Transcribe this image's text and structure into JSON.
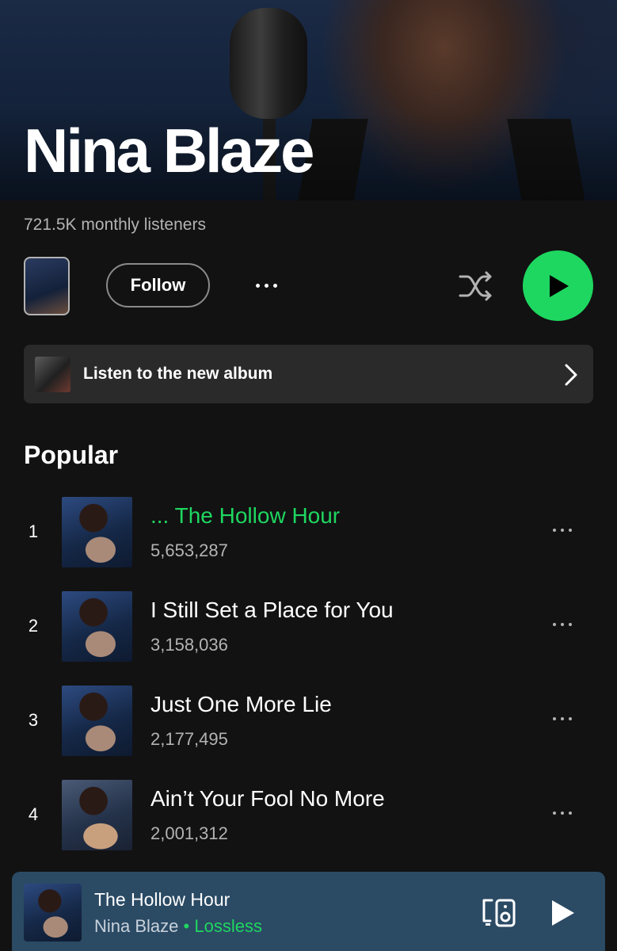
{
  "artist": {
    "name": "Nina Blaze",
    "monthly_listeners": "721.5K monthly listeners"
  },
  "actions": {
    "follow_label": "Follow"
  },
  "banner": {
    "label": "Listen to the new album"
  },
  "popular": {
    "title": "Popular",
    "tracks": [
      {
        "num": "1",
        "title": "... The Hollow Hour",
        "plays": "5,653,287",
        "playing": true
      },
      {
        "num": "2",
        "title": "I Still Set a Place for You",
        "plays": "3,158,036",
        "playing": false
      },
      {
        "num": "3",
        "title": "Just One More Lie",
        "plays": "2,177,495",
        "playing": false
      },
      {
        "num": "4",
        "title": "Ain’t Your Fool No More",
        "plays": "2,001,312",
        "playing": false
      }
    ]
  },
  "now_playing": {
    "title": "The Hollow Hour",
    "artist": "Nina Blaze",
    "separator": "•",
    "quality": "Lossless"
  },
  "colors": {
    "accent": "#1ed760",
    "background": "#121212",
    "mini_player_bg": "#2b4a64",
    "banner_bg": "#2a2a2a"
  },
  "icons": [
    "more-icon",
    "shuffle-icon",
    "play-icon",
    "chevron-right-icon",
    "connect-device-icon"
  ]
}
